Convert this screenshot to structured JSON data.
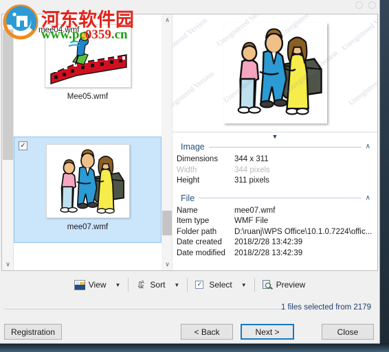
{
  "window": {
    "controls": [
      "minimize-dot",
      "maximize-dot"
    ]
  },
  "logo_watermark": {
    "site_name_cn": "河东软件园",
    "url_prefix": "www.pc",
    "url_digits": "0359",
    "url_suffix": ".cn",
    "colors": {
      "red": "#e2231a",
      "green": "#1fa014",
      "blue": "#2d9ad6",
      "orange": "#ef8b22"
    },
    "overlapped_label": "mee04.wmf"
  },
  "thumbnails": {
    "items": [
      {
        "label": "Mee05.wmf",
        "checked": false,
        "selected": false,
        "check_glyph": ""
      },
      {
        "label": "mee07.wmf",
        "checked": true,
        "selected": true,
        "check_glyph": "✓"
      }
    ],
    "scroll_up_glyph": "∧",
    "scroll_down_glyph": "∨"
  },
  "preview": {
    "watermark_text": "Unregistered Version",
    "splitter_glyph": "▼"
  },
  "properties": {
    "sections": [
      {
        "title": "Image",
        "collapse_glyph": "∧",
        "rows": [
          {
            "key": "Dimensions",
            "value": "344 x 311",
            "dim": false
          },
          {
            "key": "Width",
            "value": "344 pixels",
            "dim": true
          },
          {
            "key": "Height",
            "value": "311 pixels",
            "dim": false
          }
        ]
      },
      {
        "title": "File",
        "collapse_glyph": "∧",
        "rows": [
          {
            "key": "Name",
            "value": "mee07.wmf",
            "dim": false
          },
          {
            "key": "Item type",
            "value": "WMF File",
            "dim": false
          },
          {
            "key": "Folder path",
            "value": "D:\\ruanj\\WPS Office\\10.1.0.7224\\offic...",
            "dim": false
          },
          {
            "key": "Date created",
            "value": "2018/2/28 13:42:39",
            "dim": false
          },
          {
            "key": "Date modified",
            "value": "2018/2/28 13:42:39",
            "dim": false
          }
        ]
      }
    ]
  },
  "toolbar": {
    "view_label": "View",
    "sort_label": "Sort",
    "select_label": "Select",
    "preview_label": "Preview",
    "caret_glyph": "▼",
    "sort_a": "A",
    "sort_z": "Z",
    "sort_arrow_glyph": "⇩",
    "select_check_glyph": "✓",
    "icons": {
      "view": "picture-icon",
      "sort": "sort-az-icon",
      "select": "checkbox-icon",
      "preview": "magnifier-document-icon"
    }
  },
  "status": {
    "text": "1 files selected from 2179"
  },
  "footer": {
    "registration_label": "Registration",
    "back_label": "< Back",
    "next_label": "Next >",
    "close_label": "Close",
    "default_button": "Next >",
    "accent_color": "#1679c4"
  }
}
